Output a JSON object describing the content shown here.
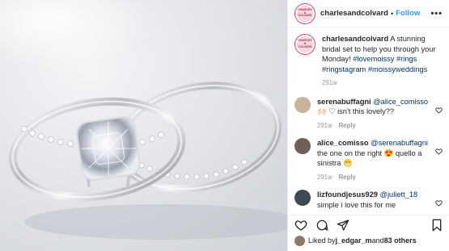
{
  "post": {
    "username": "charlesandcolvard",
    "follow_label": "Follow",
    "separator": "•",
    "avatar_text": "CHARLES & COLVARD",
    "more_icon": "more-horizontal-icon"
  },
  "caption": {
    "username": "charlesandcolvard",
    "text": " A stunning bridal set to help you through your Monday! ",
    "tags": "#lovemoissy #rings #ringstagram #moissyweddings",
    "time": "291w"
  },
  "comments": [
    {
      "username": "serenabuffagni",
      "mention": "@alice_comisso",
      "text": " 🙌🏻 ♡ isn't this lovely??",
      "time": "291w",
      "reply_label": "Reply",
      "avatar_color": "#c9b59d"
    },
    {
      "username": "alice_comisso",
      "mention": "@serenabuffagni",
      "text": " the one on the right 😍 quello a sinistra 😁",
      "time": "291w",
      "reply_label": "Reply",
      "avatar_color": "#6e5f58"
    },
    {
      "username": "lizfoundjesus929",
      "mention": "@juliett_18",
      "text": " simple i love this for me",
      "time": "",
      "reply_label": "",
      "avatar_color": "#3e4a52"
    }
  ],
  "likes": {
    "prefix": "Liked by ",
    "user": "j_edgar_m",
    "middle": " and ",
    "others": "83 others"
  },
  "colors": {
    "accent": "#3897f0",
    "tag": "#003569",
    "muted": "#999999",
    "brand_ring": "#e0406e"
  }
}
